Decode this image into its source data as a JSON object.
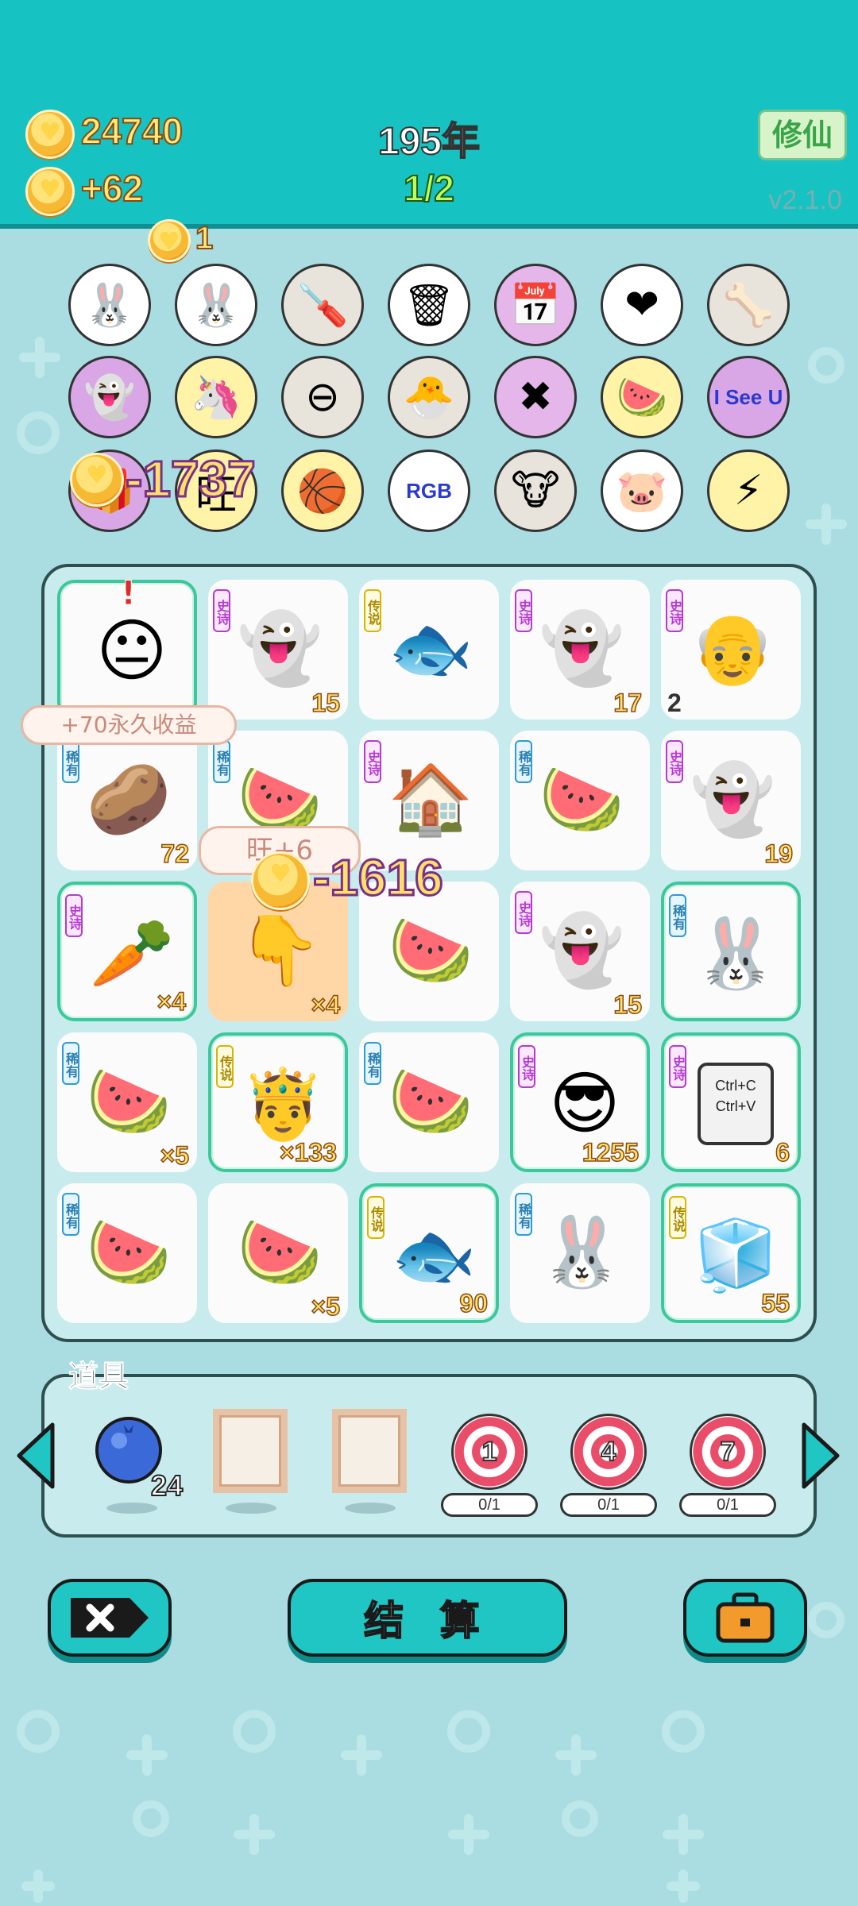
{
  "header": {
    "coins": "24740",
    "income": "+62",
    "year": "195年",
    "progress": "1/2",
    "xiuxian_button": "修仙",
    "version": "v2.1.0"
  },
  "top_strip": {
    "count": "1"
  },
  "items_rows": [
    [
      {
        "icon": "bunny-icon",
        "glyph": "🐰",
        "bg": "#ffffff"
      },
      {
        "icon": "bunny-icon",
        "glyph": "🐰",
        "bg": "#ffffff"
      },
      {
        "icon": "screwdriver-icon",
        "glyph": "🪛",
        "bg": "#e8e4dc"
      },
      {
        "icon": "trash-bag-icon",
        "glyph": "🗑",
        "bg": "#ffffff"
      },
      {
        "icon": "calendar-icon",
        "glyph": "📅",
        "bg": "#e4b6ea"
      },
      {
        "icon": "blood-bag-icon",
        "glyph": "❤",
        "bg": "#ffffff"
      },
      {
        "icon": "pet-food-icon",
        "glyph": "🦴",
        "bg": "#e8e4dc"
      }
    ],
    [
      {
        "icon": "ghost-icon",
        "glyph": "👻",
        "bg": "#d9a6e6"
      },
      {
        "icon": "unicorn-icon",
        "glyph": "🦄",
        "bg": "#fff3a8"
      },
      {
        "icon": "minus-icon",
        "glyph": "⊖",
        "bg": "#e8e4dc"
      },
      {
        "icon": "chick-icon",
        "glyph": "🐣",
        "bg": "#e8e4dc"
      },
      {
        "icon": "delete-tag-icon",
        "glyph": "✖",
        "bg": "#e4b6ea"
      },
      {
        "icon": "fruit-basket-icon",
        "glyph": "🍉",
        "bg": "#fff3a8"
      },
      {
        "icon": "i-see-u-sign-icon",
        "glyph": "I See U",
        "bg": "#d9a6e6"
      }
    ],
    [
      {
        "icon": "gift-icon",
        "glyph": "🎁",
        "bg": "#d9a6e6"
      },
      {
        "icon": "wang-dog-icon",
        "glyph": "旺",
        "bg": "#fff3a8"
      },
      {
        "icon": "basketballs-icon",
        "glyph": "🏀",
        "bg": "#fff3a8"
      },
      {
        "icon": "rgb-icon",
        "glyph": "RGB",
        "bg": "#ffffff"
      },
      {
        "icon": "cows-icon",
        "glyph": "🐮",
        "bg": "#e8e4dc"
      },
      {
        "icon": "piggy-bank-icon",
        "glyph": "🐷",
        "bg": "#ffffff"
      },
      {
        "icon": "lightning-icon",
        "glyph": "⚡",
        "bg": "#fff3a8"
      }
    ]
  ],
  "board": {
    "cells": [
      {
        "icon": "boy-face-icon",
        "glyph": "😐",
        "tag": "",
        "tag_type": "",
        "count": "",
        "glow": true,
        "alert": "!"
      },
      {
        "icon": "ghost-icon",
        "glyph": "👻",
        "tag": "史诗",
        "tag_type": "epic",
        "count": "15"
      },
      {
        "icon": "koi-fish-icon",
        "glyph": "🐟",
        "tag": "传说",
        "tag_type": "legend",
        "count": ""
      },
      {
        "icon": "ghost-icon",
        "glyph": "👻",
        "tag": "史诗",
        "tag_type": "epic",
        "count": "17"
      },
      {
        "icon": "grandpa-face-icon",
        "glyph": "👴",
        "tag": "史诗",
        "tag_type": "epic",
        "count": "2",
        "count_left": true
      },
      {
        "icon": "sparkle-potato-icon",
        "glyph": "🥔",
        "tag": "稀有",
        "tag_type": "rare",
        "count": "72"
      },
      {
        "icon": "watermelon-icon",
        "glyph": "🍉",
        "tag": "稀有",
        "tag_type": "rare",
        "count": ""
      },
      {
        "icon": "bunny-house-icon",
        "glyph": "🏠",
        "tag": "史诗",
        "tag_type": "epic",
        "count": ""
      },
      {
        "icon": "watermelon-icon",
        "glyph": "🍉",
        "tag": "稀有",
        "tag_type": "rare",
        "count": ""
      },
      {
        "icon": "ghost-icon",
        "glyph": "👻",
        "tag": "史诗",
        "tag_type": "epic",
        "count": "19"
      },
      {
        "icon": "carrot-icon",
        "glyph": "🥕",
        "tag": "史诗",
        "tag_type": "epic",
        "count": "×4",
        "glow": true
      },
      {
        "icon": "pointing-hand-icon",
        "glyph": "👇",
        "tag": "",
        "tag_type": "",
        "count": "×4",
        "orange": true
      },
      {
        "icon": "watermelon-slice-icon",
        "glyph": "🍉",
        "tag": "",
        "tag_type": "",
        "count": ""
      },
      {
        "icon": "ghost-icon",
        "glyph": "👻",
        "tag": "史诗",
        "tag_type": "epic",
        "count": "15"
      },
      {
        "icon": "bunny-book-icon",
        "glyph": "🐰",
        "tag": "稀有",
        "tag_type": "rare",
        "count": "",
        "glow": true
      },
      {
        "icon": "watermelon-icon",
        "glyph": "🍉",
        "tag": "稀有",
        "tag_type": "rare",
        "count": "×5"
      },
      {
        "icon": "king-grandpa-icon",
        "glyph": "🤴",
        "tag": "传说",
        "tag_type": "legend",
        "count": "×133",
        "glow": true
      },
      {
        "icon": "watermelon-icon",
        "glyph": "🍉",
        "tag": "稀有",
        "tag_type": "rare",
        "count": ""
      },
      {
        "icon": "king-sunglasses-icon",
        "glyph": "😎",
        "tag": "史诗",
        "tag_type": "epic",
        "count": "1255",
        "glow": true
      },
      {
        "icon": "copy-paste-icon",
        "glyph": "📋",
        "tag": "史诗",
        "tag_type": "epic",
        "count": "6",
        "glow": true,
        "card_text": [
          "Ctrl+C",
          "Ctrl+V"
        ]
      },
      {
        "icon": "watermelon-icon",
        "glyph": "🍉",
        "tag": "稀有",
        "tag_type": "rare",
        "count": ""
      },
      {
        "icon": "watermelon-slice-icon",
        "glyph": "🍉",
        "tag": "",
        "tag_type": "",
        "count": "×5"
      },
      {
        "icon": "koi-fish-icon",
        "glyph": "🐟",
        "tag": "传说",
        "tag_type": "legend",
        "count": "90",
        "glow": true
      },
      {
        "icon": "bunny-book-icon",
        "glyph": "🐰",
        "tag": "稀有",
        "tag_type": "rare",
        "count": ""
      },
      {
        "icon": "fridge-icon",
        "glyph": "🧊",
        "tag": "传说",
        "tag_type": "legend",
        "count": "55",
        "glow": true
      }
    ]
  },
  "floats": {
    "minus_1737": "-1737",
    "minus_1616": "-1616",
    "permanent_bubble": "+70永久收益",
    "wang_bubble": "旺+6"
  },
  "tools": {
    "title": "道具",
    "blueberry_count": "24",
    "targets": [
      {
        "number": "1",
        "progress": "0/1"
      },
      {
        "number": "4",
        "progress": "0/1"
      },
      {
        "number": "7",
        "progress": "0/1"
      }
    ]
  },
  "buttons": {
    "settle": "结 算"
  }
}
